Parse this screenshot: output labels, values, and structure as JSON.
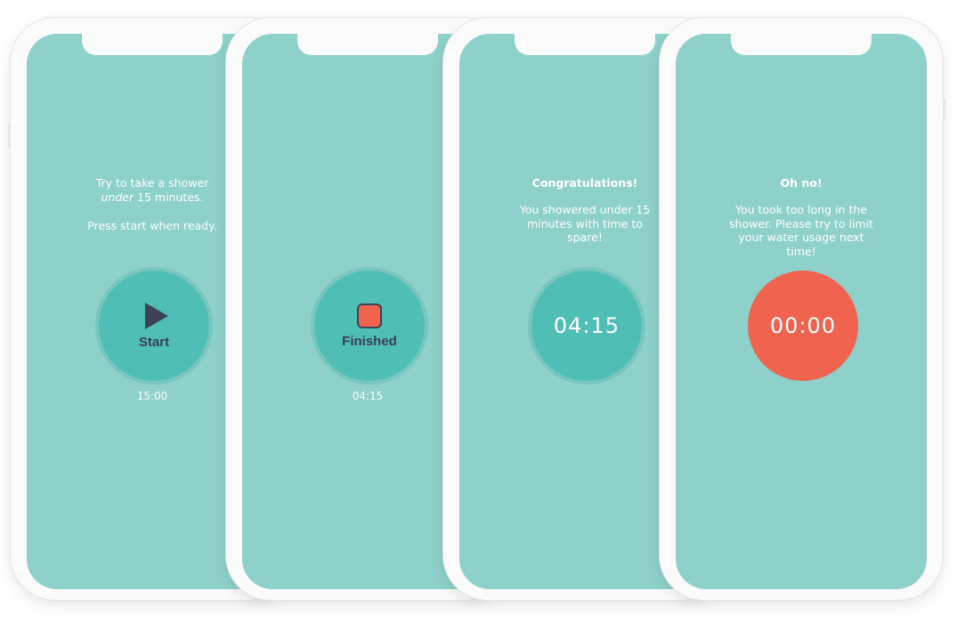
{
  "screens": [
    {
      "line1": "Try to take a shower",
      "line2_emph": "under",
      "line2_rest": " 15 minutes.",
      "line3": "Press start when ready.",
      "button_label": "Start",
      "button_icon": "play-icon",
      "time_below": "15:00"
    },
    {
      "button_label": "Finished",
      "button_icon": "stop-icon",
      "time_below": "04:15"
    },
    {
      "title": "Congratulations!",
      "message": "You showered under 15 minutes with time to spare!",
      "timer": "04:15"
    },
    {
      "title": "Oh no!",
      "message": "You took too long in the shower. Please try to limit your water usage next time!",
      "timer": "00:00"
    }
  ],
  "colors": {
    "screen_bg": "#8ed0ca",
    "button_teal": "#4fbfb5",
    "button_red": "#f0634f",
    "icon_dark": "#3d4256"
  }
}
